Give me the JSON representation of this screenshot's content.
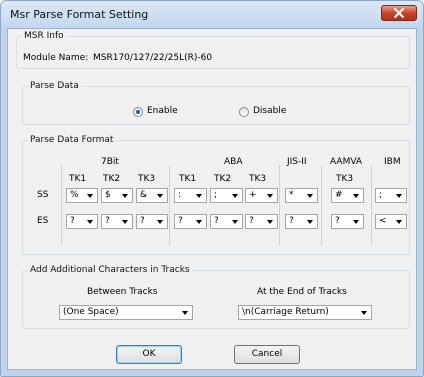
{
  "window": {
    "title": "Msr Parse Format Setting"
  },
  "msr_info": {
    "legend": "MSR Info",
    "module_label": "Module Name:",
    "module_value": "MSR170/127/22/25L(R)-60"
  },
  "parse_data": {
    "legend": "Parse Data",
    "options": [
      {
        "label": "Enable",
        "selected": true
      },
      {
        "label": "Disable",
        "selected": false
      }
    ]
  },
  "format": {
    "legend": "Parse Data Format",
    "groups": [
      {
        "label": "7Bit"
      },
      {
        "label": "ABA"
      },
      {
        "label": "JIS-II"
      },
      {
        "label": "AAMVA"
      },
      {
        "label": "IBM"
      }
    ],
    "tracks": [
      "TK1",
      "TK2",
      "TK3",
      "TK1",
      "TK2",
      "TK3",
      "TK3"
    ],
    "rows": [
      {
        "label": "SS",
        "values": [
          "%",
          "$",
          "&",
          ":",
          ";",
          "+",
          "*",
          "#",
          ";"
        ]
      },
      {
        "label": "ES",
        "values": [
          "?",
          "?",
          "?",
          "?",
          "?",
          "?",
          "?",
          "?",
          "<"
        ]
      }
    ]
  },
  "additional": {
    "legend": "Add Additional Characters in Tracks",
    "between": {
      "label": "Between Tracks",
      "value": "(One Space)"
    },
    "end": {
      "label": "At the End of Tracks",
      "value": "\\n(Carriage Return)"
    }
  },
  "buttons": {
    "ok": "OK",
    "cancel": "Cancel"
  }
}
